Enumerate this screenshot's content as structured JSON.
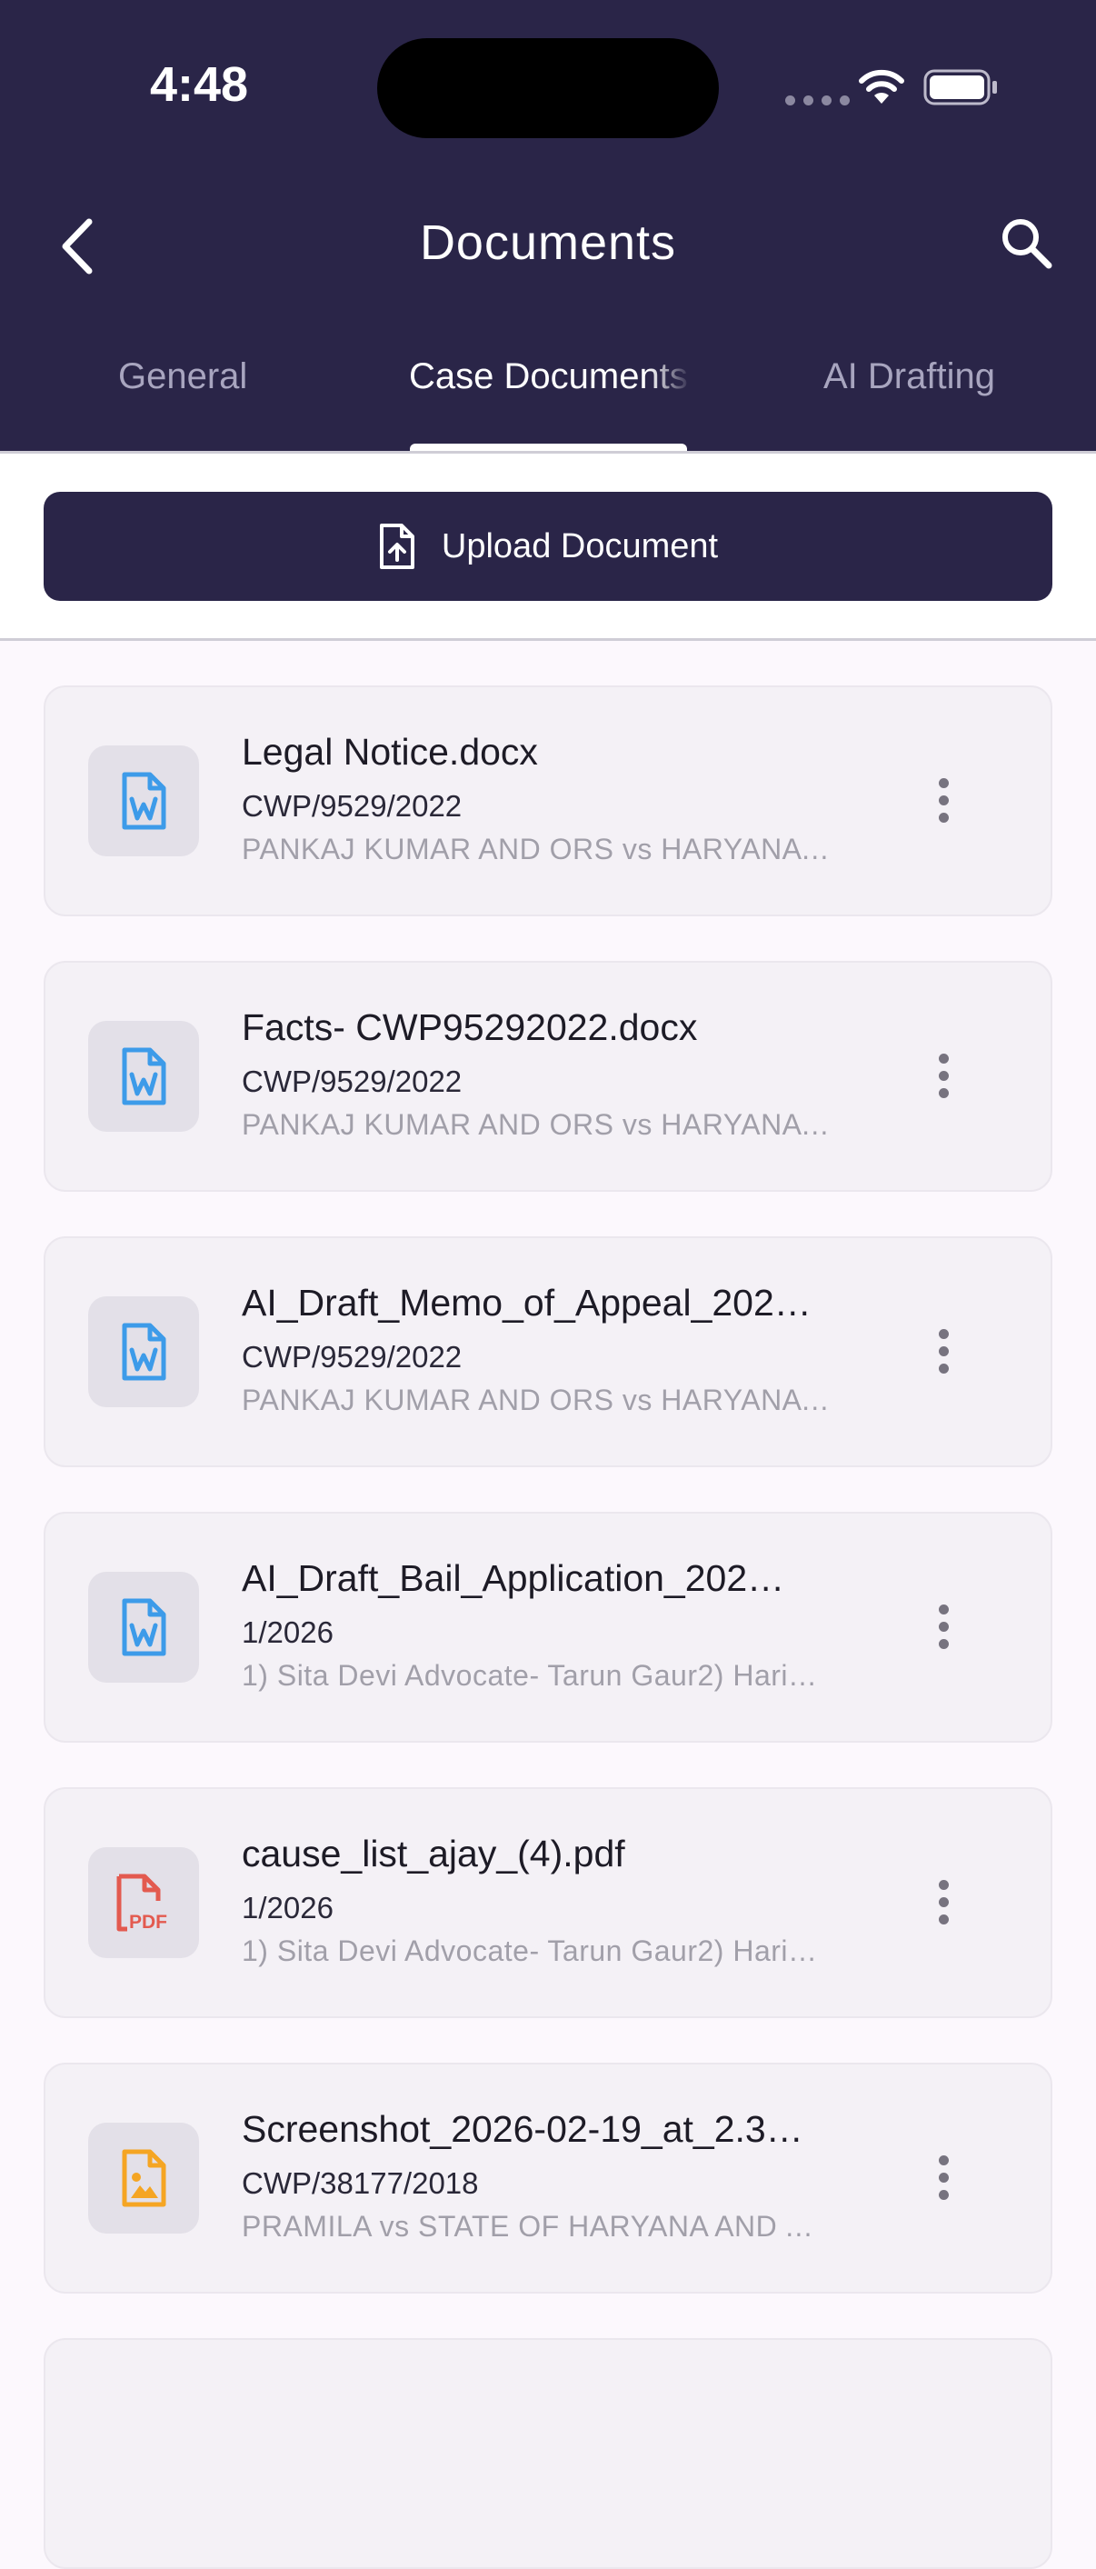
{
  "status_bar": {
    "time": "4:48"
  },
  "header": {
    "title": "Documents",
    "tabs": [
      {
        "label": "General"
      },
      {
        "label": "Case Documents"
      },
      {
        "label": "AI Drafting"
      }
    ]
  },
  "upload": {
    "label": "Upload Document"
  },
  "documents": [
    {
      "name": "Legal Notice.docx",
      "case_no": "CWP/9529/2022",
      "parties": "PANKAJ KUMAR AND ORS vs HARYANA …",
      "type": "word"
    },
    {
      "name": "Facts- CWP95292022.docx",
      "case_no": "CWP/9529/2022",
      "parties": "PANKAJ KUMAR AND ORS vs HARYANA …",
      "type": "word"
    },
    {
      "name": "AI_Draft_Memo_of_Appeal_202…",
      "case_no": "CWP/9529/2022",
      "parties": "PANKAJ KUMAR AND ORS vs HARYANA …",
      "type": "word"
    },
    {
      "name": "AI_Draft_Bail_Application_202…",
      "case_no": "1/2026",
      "parties": "1) Sita Devi Advocate- Tarun Gaur2)  Hari…",
      "type": "word"
    },
    {
      "name": "cause_list_ajay_(4).pdf",
      "case_no": "1/2026",
      "parties": "1) Sita Devi Advocate- Tarun Gaur2)  Hari…",
      "type": "pdf",
      "badge": "PDF"
    },
    {
      "name": "Screenshot_2026-02-19_at_2.3…",
      "case_no": "CWP/38177/2018",
      "parties": "PRAMILA vs STATE OF HARYANA AND A…",
      "type": "image"
    }
  ],
  "colors": {
    "primary": "#2a2548",
    "word_icon": "#3d9be9",
    "pdf_icon": "#e35a4f",
    "image_icon": "#f5a523"
  }
}
